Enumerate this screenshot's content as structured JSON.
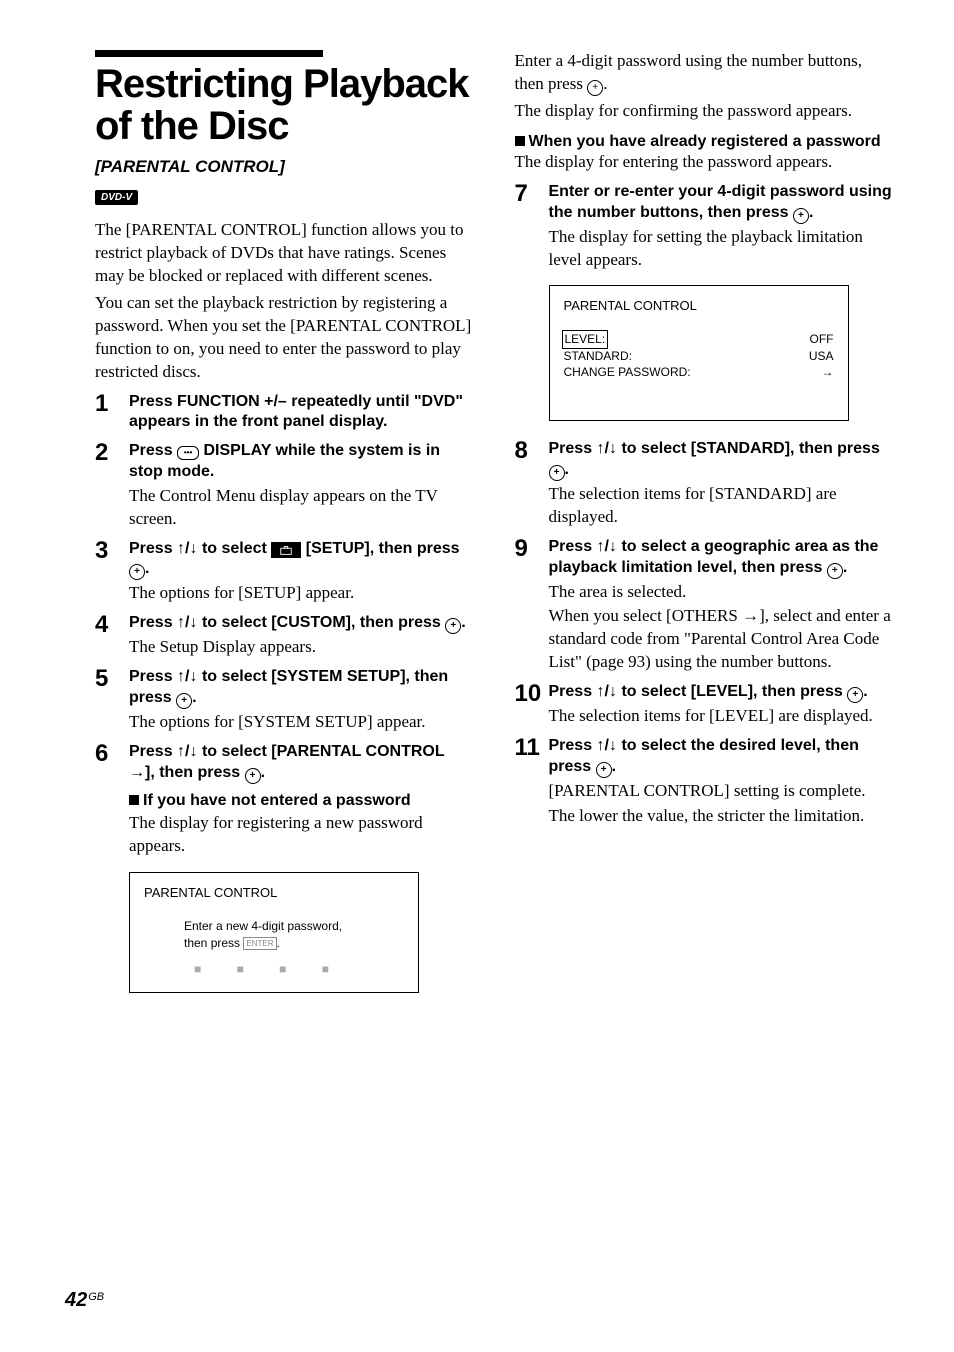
{
  "title": "Restricting Playback of the Disc",
  "subtitle": "[PARENTAL CONTROL]",
  "badge": "DVD-V",
  "intro1": "The [PARENTAL CONTROL] function allows you to restrict playback of DVDs that have ratings. Scenes may be blocked or replaced with different scenes.",
  "intro2": "You can set the playback restriction by registering a password. When you set the [PARENTAL CONTROL] function to on, you need to enter the password to play restricted discs.",
  "steps_left": [
    {
      "num": "1",
      "head": "Press FUNCTION +/– repeatedly until \"DVD\" appears in the front panel display."
    },
    {
      "num": "2",
      "head_pre": "Press ",
      "head_post": " DISPLAY while the system is in stop mode.",
      "body": "The Control Menu display appears on the TV screen."
    },
    {
      "num": "3",
      "head_pre": "Press ",
      "arrows": "↑/↓",
      "head_mid": " to select ",
      "head_post2": "   [SETUP], then press ",
      "head_end": ".",
      "body": "The options for [SETUP] appear."
    },
    {
      "num": "4",
      "head_pre": "Press ",
      "arrows": "↑/↓",
      "head_mid": " to select [CUSTOM], then press ",
      "head_end": ".",
      "body": "The Setup Display appears."
    },
    {
      "num": "5",
      "head_pre": "Press ",
      "arrows": "↑/↓",
      "head_mid": " to select [SYSTEM SETUP], then press ",
      "head_end": ".",
      "body": "The options for [SYSTEM SETUP] appear."
    },
    {
      "num": "6",
      "head_pre": "Press ",
      "arrows": "↑/↓",
      "head_mid": " to select [PARENTAL CONTROL →], then press ",
      "head_end": "."
    }
  ],
  "sub_left": {
    "heading": "If you have not entered a password",
    "body": "The display for registering a new password appears."
  },
  "osd_left": {
    "title": "PARENTAL CONTROL",
    "line1": "Enter a new 4-digit password,",
    "line2_pre": "then press ",
    "line2_key": "ENTER",
    "line2_post": ".",
    "digits": "■  ■  ■  ■"
  },
  "right_top": {
    "p1_pre": "Enter a 4-digit password using the number buttons, then press ",
    "p1_post": ".",
    "p2": "The display for confirming the password appears."
  },
  "sub_right": {
    "heading": "When you have already registered a password",
    "body": "The display for entering the password appears."
  },
  "steps_right": [
    {
      "num": "7",
      "head_pre": "Enter or re-enter your 4-digit password using the number buttons, then press ",
      "head_end": ".",
      "body": "The display for setting the playback limitation level appears."
    },
    {
      "num": "8",
      "head_pre": "Press ",
      "arrows": "↑/↓",
      "head_mid": " to select [STANDARD], then press ",
      "head_end": ".",
      "body": "The selection items for [STANDARD] are displayed."
    },
    {
      "num": "9",
      "head_pre": "Press ",
      "arrows": "↑/↓",
      "head_mid": " to select a geographic area as the playback limitation level, then press ",
      "head_end": ".",
      "body1": "The area is selected.",
      "body2": "When you select [OTHERS →], select and enter a standard code from \"Parental Control Area Code List\" (page 93) using the number buttons."
    },
    {
      "num": "10",
      "head_pre": "Press ",
      "arrows": "↑/↓",
      "head_mid": " to select [LEVEL], then press ",
      "head_end": ".",
      "body": "The selection items for [LEVEL] are displayed."
    },
    {
      "num": "11",
      "head_pre": "Press ",
      "arrows": "↑/↓",
      "head_mid": " to select the desired level, then press ",
      "head_end": ".",
      "body1": "[PARENTAL CONTROL] setting is complete.",
      "body2": "The lower the value, the stricter the limitation."
    }
  ],
  "osd_right": {
    "title": "PARENTAL CONTROL",
    "rows": [
      {
        "label": "LEVEL:",
        "value": "OFF",
        "hl": true
      },
      {
        "label": "STANDARD:",
        "value": "USA"
      },
      {
        "label": "CHANGE PASSWORD:",
        "value": "→"
      }
    ]
  },
  "page_number": "42",
  "page_suffix": "GB"
}
